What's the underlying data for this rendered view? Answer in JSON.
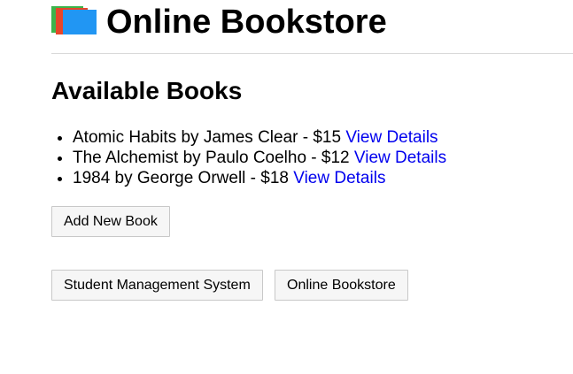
{
  "header": {
    "title": "Online Bookstore",
    "logo_icon": "books-logo-icon"
  },
  "main": {
    "section_title": "Available Books",
    "books": [
      {
        "text": "Atomic Habits by James Clear - $15",
        "link_label": "View Details"
      },
      {
        "text": "The Alchemist by Paulo Coelho - $12",
        "link_label": "View Details"
      },
      {
        "text": "1984 by George Orwell - $18",
        "link_label": "View Details"
      }
    ],
    "add_button_label": "Add New Book"
  },
  "nav": {
    "buttons": [
      {
        "label": "Student Management System"
      },
      {
        "label": "Online Bookstore"
      }
    ]
  },
  "colors": {
    "link": "#0000ee",
    "logo_green": "#3cb44b",
    "logo_red": "#e6462a",
    "logo_blue": "#2196f3",
    "button_bg": "#f6f6f6"
  }
}
